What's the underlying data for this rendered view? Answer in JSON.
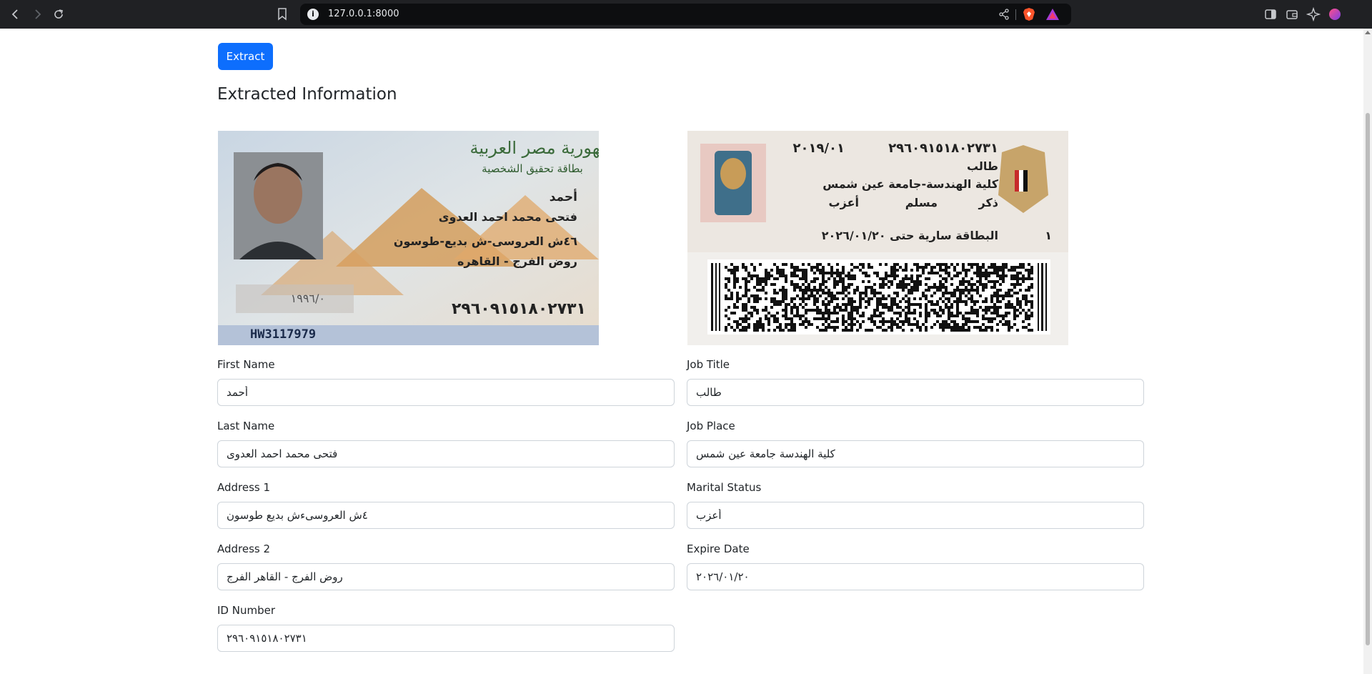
{
  "browser": {
    "url": "127.0.0.1:8000"
  },
  "page": {
    "extract_button": "Extract",
    "heading": "Extracted Information"
  },
  "id_front": {
    "republic": "جمهورية مصر العربية",
    "card_title": "بطاقة تحقيق الشخصية",
    "first_name": "أحمد",
    "full_name": "فتحى محمد احمد العدوى",
    "address_line1": "٤٦ش العروسى-ش بديع-طوسون",
    "address_line2": "روض الفرج - القاهره",
    "birth_date": "١٩٩٦/٠",
    "id_number": "٢٩٦٠٩١٥١٨٠٢٧٣١",
    "serial": "HW3117979"
  },
  "id_back": {
    "issue_date": "٢٠١٩/٠١",
    "id_number": "٢٩٦٠٩١٥١٨٠٢٧٣١",
    "job_title": "طالب",
    "job_place": "كلية الهندسة-جامعة عين شمس",
    "gender": "ذكر",
    "religion": "مسلم",
    "marital_status": "أعزب",
    "validity": "البطاقة سارية حتى ٢٠٢٦/٠١/٢٠",
    "digit": "١"
  },
  "fields": {
    "first_name": {
      "label": "First Name",
      "value": "أحمد"
    },
    "last_name": {
      "label": "Last Name",
      "value": "فتحى محمد احمد العدوى"
    },
    "address1": {
      "label": "Address 1",
      "value": "٤ش العروسىءش بديع طوسون"
    },
    "address2": {
      "label": "Address 2",
      "value": "روض الفرج - القاهر الفرج"
    },
    "id_number": {
      "label": "ID Number",
      "value": "٢٩٦٠٩١٥١٨٠٢٧٣١"
    },
    "job_title": {
      "label": "Job Title",
      "value": "طالب"
    },
    "job_place": {
      "label": "Job Place",
      "value": "كلية الهندسة جامعة عين شمس"
    },
    "marital_status": {
      "label": "Marital Status",
      "value": "أعزب"
    },
    "expire_date": {
      "label": "Expire Date",
      "value": "٢٠٢٦/٠١/٢٠"
    }
  },
  "colors": {
    "primary": "#0d6efd",
    "chrome_bg": "#202124",
    "omnibox_bg": "#0d0e10"
  }
}
